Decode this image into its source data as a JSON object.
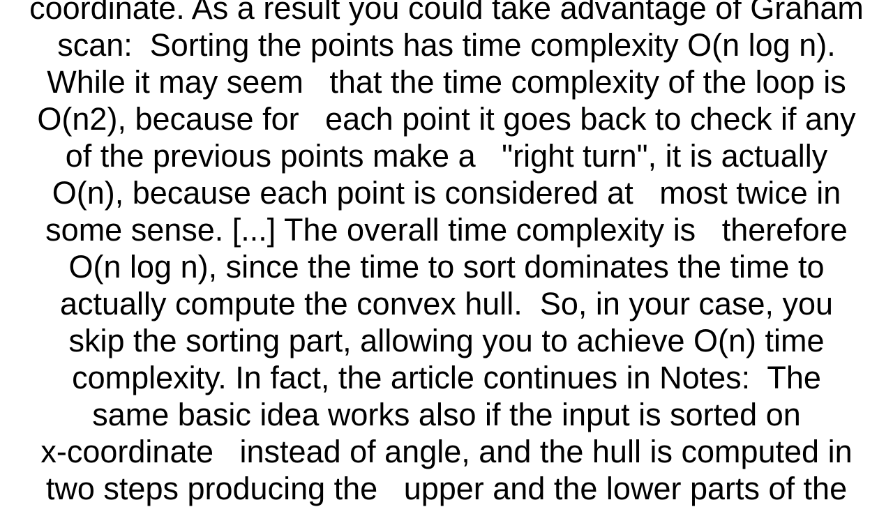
{
  "document": {
    "lines": [
      "coordinate. As a result you could take advantage of Graham",
      "scan:  Sorting the points has time complexity O(n log n).",
      "While it may seem   that the time complexity of the loop is",
      "O(n2), because for   each point it goes back to check if any",
      "of the previous points make a   \"right turn\", it is actually",
      "O(n), because each point is considered at   most twice in",
      "some sense. [...] The overall time complexity is   therefore",
      "O(n log n), since the time to sort dominates the time to",
      "actually compute the convex hull.  So, in your case, you",
      "skip the sorting part, allowing you to achieve O(n) time",
      "complexity. In fact, the article continues in Notes:  The",
      "same basic idea works also if the input is sorted on",
      "x-coordinate   instead of angle, and the hull is computed in",
      "two steps producing the   upper and the lower parts of the"
    ]
  }
}
